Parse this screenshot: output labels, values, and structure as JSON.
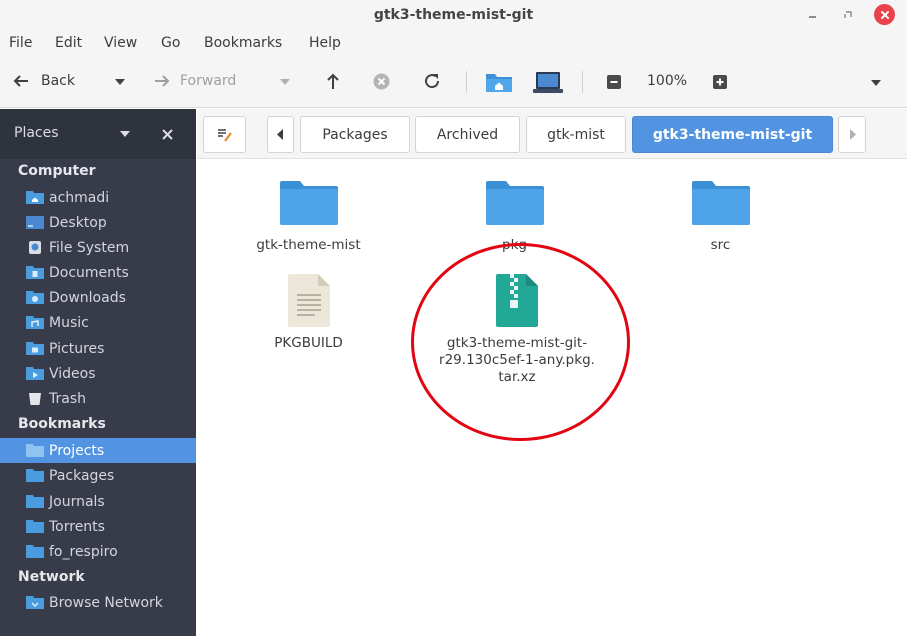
{
  "window": {
    "title": "gtk3-theme-mist-git"
  },
  "menubar": {
    "items": [
      "File",
      "Edit",
      "View",
      "Go",
      "Bookmarks",
      "Help"
    ]
  },
  "toolbar": {
    "back_label": "Back",
    "forward_label": "Forward",
    "zoom_label": "100%"
  },
  "sidebar": {
    "header_label": "Places",
    "sections": {
      "computer": "Computer",
      "bookmarks": "Bookmarks",
      "network": "Network"
    },
    "computer_items": [
      "achmadi",
      "Desktop",
      "File System",
      "Documents",
      "Downloads",
      "Music",
      "Pictures",
      "Videos",
      "Trash"
    ],
    "bookmark_items": [
      "Projects",
      "Packages",
      "Journals",
      "Torrents",
      "fo_respiro"
    ],
    "network_items": [
      "Browse Network"
    ],
    "active_item": "Projects"
  },
  "pathbar": {
    "crumbs": [
      "Packages",
      "Archived",
      "gtk-mist",
      "gtk3-theme-mist-git"
    ],
    "current": "gtk3-theme-mist-git"
  },
  "files": [
    {
      "name": "gtk-theme-mist",
      "icon": "folder-icon"
    },
    {
      "name": "pkg",
      "icon": "folder-icon"
    },
    {
      "name": "src",
      "icon": "folder-icon"
    },
    {
      "name": "PKGBUILD",
      "icon": "text-file-icon"
    },
    {
      "name_lines": [
        "gtk3-theme-mist-git-",
        "r29.130c5ef-1-any.pkg.",
        "tar.xz"
      ],
      "icon": "archive-icon"
    }
  ],
  "colors": {
    "accent": "#5294e2",
    "sidebar_bg": "#383c4a",
    "folder": "#4a9ce0",
    "archive": "#23a796",
    "annotation": "#e20612"
  }
}
